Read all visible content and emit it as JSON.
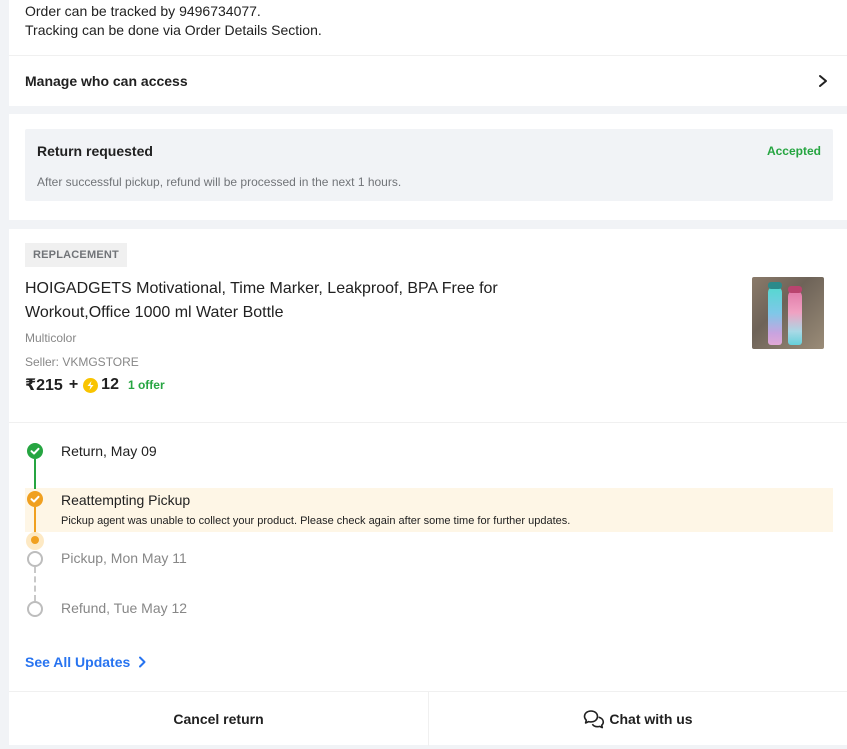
{
  "tracking": {
    "line1": "Order can be tracked by 9496734077.",
    "line2": "Tracking can be done via Order Details Section."
  },
  "manage_access": {
    "label": "Manage who can access"
  },
  "return_status": {
    "title": "Return requested",
    "badge": "Accepted",
    "description": "After successful pickup, refund will be processed in the next 1 hours."
  },
  "product": {
    "tag": "REPLACEMENT",
    "title": "HOIGADGETS Motivational, Time Marker, Leakproof, BPA Free for Workout,Office 1000 ml Water Bottle",
    "color": "Multicolor",
    "seller": "Seller: VKMGSTORE",
    "price": "₹215",
    "plus": "+",
    "coins": "12",
    "offer": "1 offer"
  },
  "timeline": {
    "steps": [
      {
        "label": "Return, May 09",
        "state": "done"
      },
      {
        "label": "Reattempting Pickup",
        "state": "current",
        "sub": "Pickup agent was unable to collect your product. Please check again after some time for further updates."
      },
      {
        "label": "Pickup, Mon May 11",
        "state": "pending"
      },
      {
        "label": "Refund, Tue May 12",
        "state": "pending"
      }
    ],
    "see_all": "See All Updates"
  },
  "actions": {
    "cancel": "Cancel return",
    "chat": "Chat with us"
  },
  "colors": {
    "green": "#26a541",
    "orange": "#f0a020",
    "blue": "#2874f0",
    "highlight": "#fef6e6"
  },
  "icons": [
    "chevron-right-icon",
    "check-icon",
    "flipkart-coin-icon",
    "chat-bubbles-icon"
  ]
}
